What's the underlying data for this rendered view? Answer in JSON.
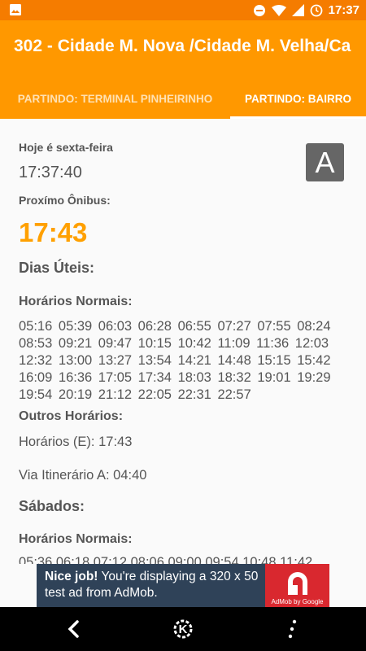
{
  "status_bar": {
    "time": "17:37",
    "icons": [
      "image-icon",
      "minus-circle-icon",
      "wifi-icon",
      "signal-icon",
      "alarm-icon"
    ]
  },
  "app_bar": {
    "title": "302 - Cidade M. Nova /Cidade M. Velha/Ca",
    "tabs": [
      {
        "label": "PARTINDO: TERMINAL PINHEIRINHO",
        "selected": false
      },
      {
        "label": "PARTINDO: BAIRRO",
        "selected": true
      }
    ]
  },
  "main": {
    "today_label": "Hoje é sexta-feira",
    "current_time": "17:37:40",
    "next_bus_label": "Proxímo Ônibus:",
    "next_bus_time": "17:43",
    "route_letter": "A",
    "weekdays": {
      "heading": "Dias Úteis:",
      "normal_heading": "Horários Normais:",
      "times": [
        "05:16",
        "05:39",
        "06:03",
        "06:28",
        "06:55",
        "07:27",
        "07:55",
        "08:24",
        "08:53",
        "09:21",
        "09:47",
        "10:15",
        "10:42",
        "11:09",
        "11:36",
        "12:03",
        "12:32",
        "13:00",
        "13:27",
        "13:54",
        "14:21",
        "14:48",
        "15:15",
        "15:42",
        "16:09",
        "16:36",
        "17:05",
        "17:34",
        "18:03",
        "18:32",
        "19:01",
        "19:29",
        "19:54",
        "20:19",
        "21:12",
        "22:05",
        "22:31",
        "22:57"
      ],
      "other_heading": "Outros Horários:",
      "other_line1": "Horários (E): 17:43",
      "other_line2": "Via Itinerário A: 04:40"
    },
    "saturdays": {
      "heading": "Sábados:",
      "normal_heading": "Horários Normais:",
      "times_partial": "05:36 06:18 07:12 08:06 09:00 09:54 10:48 11:42"
    }
  },
  "ad": {
    "bold": "Nice job!",
    "text": " You're displaying a 320 x 50 test ad from AdMob.",
    "brand": "AdMob by Google"
  },
  "nav_bar": {
    "buttons": [
      "back-icon",
      "k-logo-icon",
      "more-icon"
    ]
  }
}
